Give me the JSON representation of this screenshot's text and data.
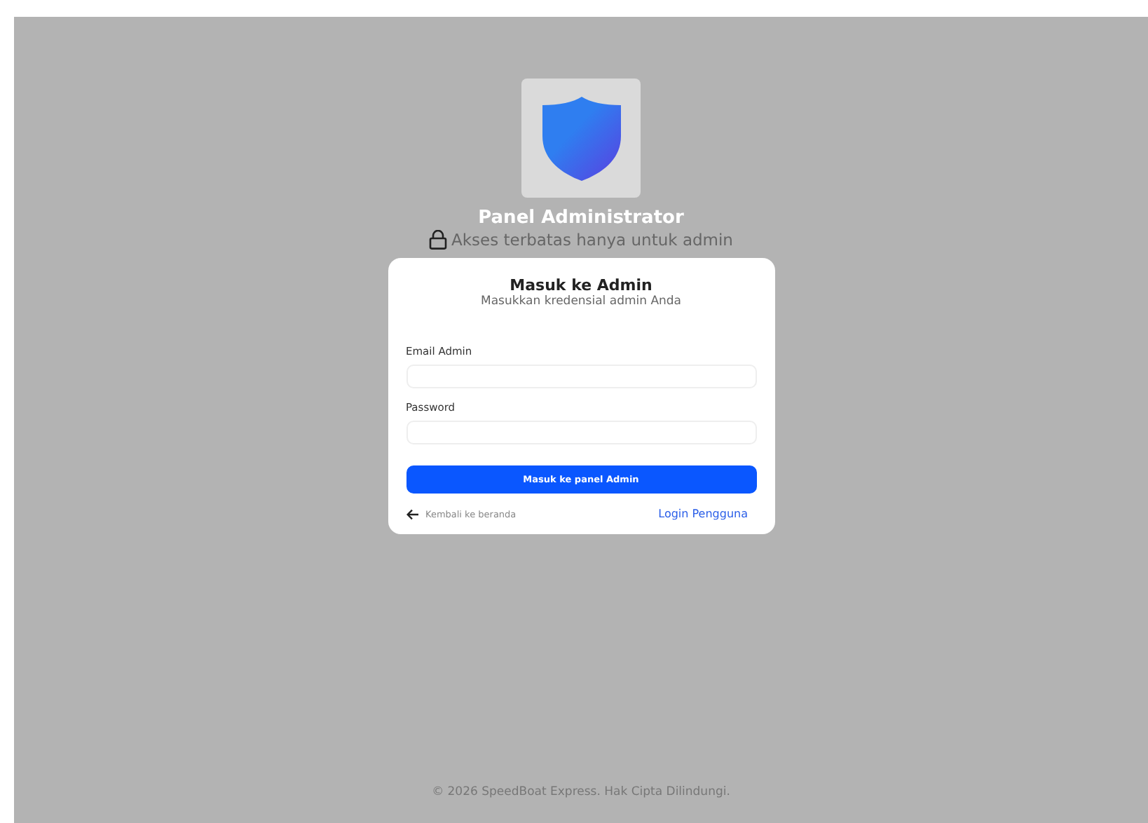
{
  "header": {
    "title": "Panel Administrator",
    "subtitle": "Akses terbatas hanya untuk admin"
  },
  "card": {
    "title": "Masuk ke Admin",
    "subtitle": "Masukkan kredensial admin Anda",
    "fields": [
      {
        "label": "Email Admin"
      },
      {
        "label": "Password"
      }
    ],
    "submit": "Masuk ke panel Admin",
    "back_link": "Kembali ke beranda",
    "user_link": "Login Pengguna"
  },
  "footer": "© 2026 SpeedBoat Express. Hak Cipta Dilindungi."
}
